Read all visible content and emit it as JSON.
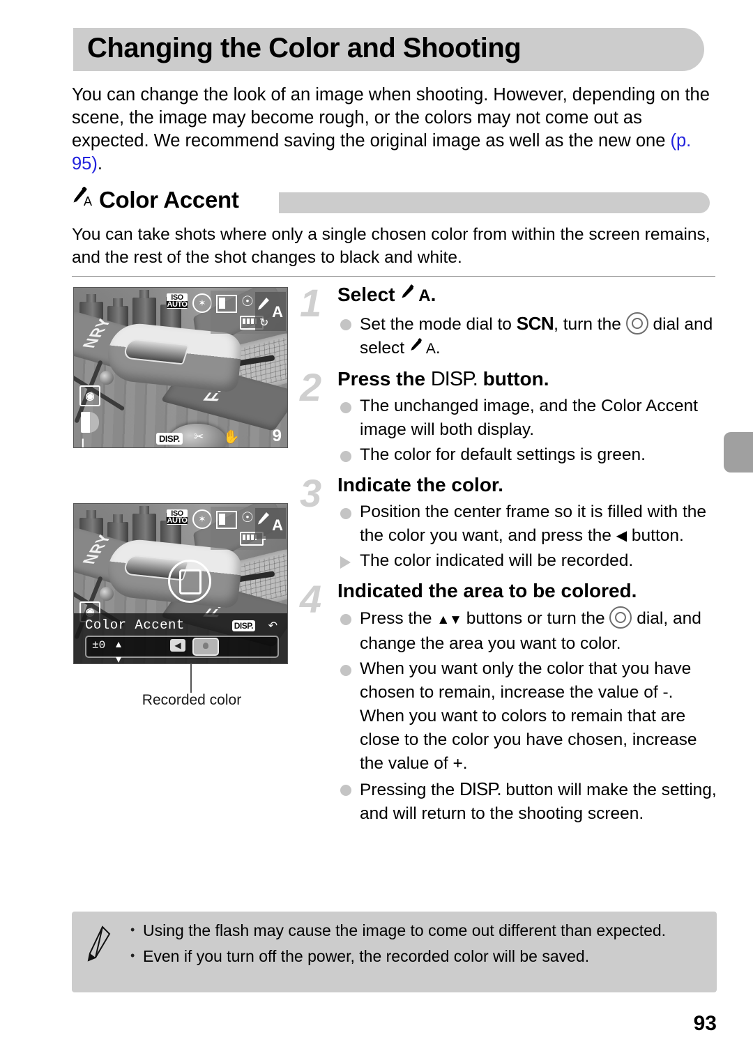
{
  "page": {
    "title": "Changing the Color and Shooting",
    "number": "93",
    "intro": {
      "before_link": "You can change the look of an image when shooting. However, depending on the scene, the image may become rough, or the colors may not come out as expected. We recommend saving the original image as well as the new one ",
      "link": "(p. 95)",
      "after_link": "."
    }
  },
  "section": {
    "icon": "color-accent-icon",
    "icon_letter": "A",
    "title": "Color Accent",
    "description": "You can take shots where only a single chosen color from within the screen remains, and the rest of the shot changes to black and white."
  },
  "steps": [
    {
      "number": "1",
      "title_before": "Select ",
      "title_icon_letter": "A",
      "title_after": ".",
      "bullets": [
        {
          "type": "dot",
          "segments": [
            {
              "kind": "text",
              "value": "Set the mode dial to "
            },
            {
              "kind": "scn",
              "value": "SCN"
            },
            {
              "kind": "text",
              "value": ", turn the "
            },
            {
              "kind": "dial",
              "value": "control-dial-icon"
            },
            {
              "kind": "text",
              "value": " dial and select "
            },
            {
              "kind": "ca",
              "value": "A"
            },
            {
              "kind": "text",
              "value": "."
            }
          ]
        }
      ]
    },
    {
      "number": "2",
      "title_before": "Press the ",
      "title_disp": "DISP.",
      "title_after": " button.",
      "bullets": [
        {
          "type": "dot",
          "text": "The unchanged image, and the Color Accent image will both display."
        },
        {
          "type": "dot",
          "text": "The color for default settings is green."
        }
      ]
    },
    {
      "number": "3",
      "title": "Indicate the color.",
      "bullets": [
        {
          "type": "dot",
          "segments": [
            {
              "kind": "text",
              "value": "Position the center frame so it is filled with the the color you want, and press the "
            },
            {
              "kind": "tri",
              "value": "◀"
            },
            {
              "kind": "text",
              "value": " button."
            }
          ]
        },
        {
          "type": "triangle",
          "text": "The color indicated will be recorded."
        }
      ]
    },
    {
      "number": "4",
      "title": "Indicated the area to be colored.",
      "bullets": [
        {
          "type": "dot",
          "segments": [
            {
              "kind": "text",
              "value": "Press the "
            },
            {
              "kind": "updown",
              "value": "▲▼"
            },
            {
              "kind": "text",
              "value": " buttons or turn the "
            },
            {
              "kind": "dial",
              "value": "control-dial-icon"
            },
            {
              "kind": "text",
              "value": " dial, and change the area you want to color."
            }
          ]
        },
        {
          "type": "dot",
          "text": "When you want only the color that you have chosen to remain, increase the value of -. When you want to colors to remain that are close to the color you have chosen, increase the value of +."
        },
        {
          "type": "dot",
          "segments": [
            {
              "kind": "text",
              "value": "Pressing the "
            },
            {
              "kind": "disp",
              "value": "DISP."
            },
            {
              "kind": "text",
              "value": " button will make the setting, and will return to the shooting screen."
            }
          ]
        }
      ]
    }
  ],
  "figures": {
    "screen1": {
      "name": "camera-lcd-shooting-screen",
      "overlays": {
        "iso_top": "ISO",
        "iso_bottom": "AUTO",
        "flash_sync": "✶",
        "metering": "◉",
        "shots_remaining": "9",
        "disp_button": "DISP.",
        "mode_letter": "A",
        "size_letter": "L"
      }
    },
    "screen2": {
      "name": "camera-lcd-color-accent-screen",
      "overlays": {
        "iso_top": "ISO",
        "iso_bottom": "AUTO",
        "panel_title": "Color Accent",
        "value": "±0",
        "disp_button": "DISP.",
        "return_glyph": "↶",
        "mode_letter": "A"
      }
    },
    "caption": "Recorded color"
  },
  "note": {
    "icon": "pencil-icon",
    "items": [
      "Using the flash may cause the image to come out different than expected.",
      "Even if you turn off the power, the recorded color will be saved."
    ]
  }
}
